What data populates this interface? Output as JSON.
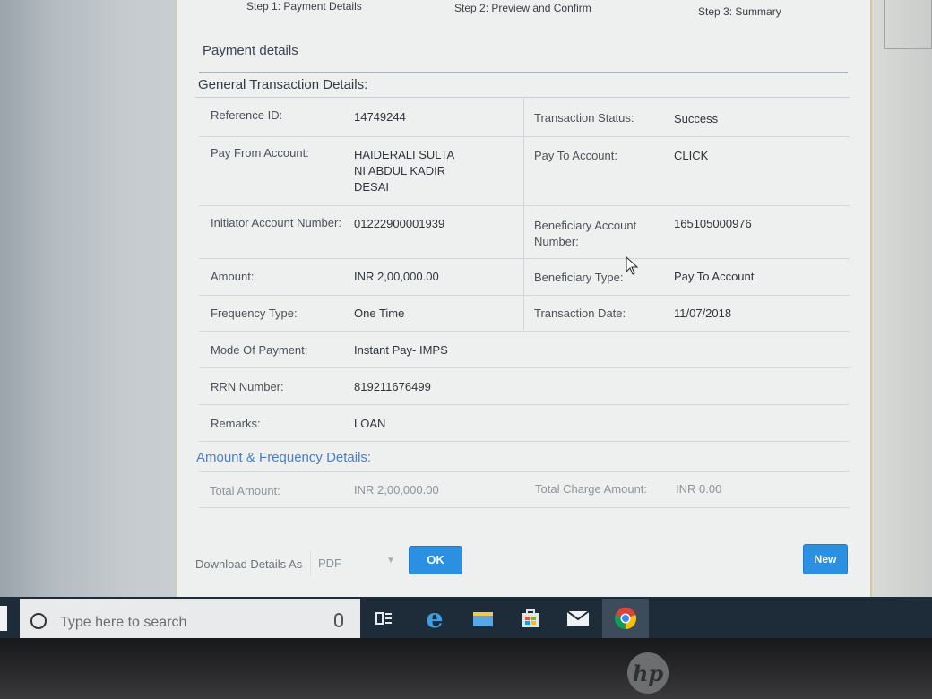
{
  "steps": [
    "Step 1: Payment Details",
    "Step 2: Preview and Confirm",
    "Step 3: Summary"
  ],
  "page_title": "Payment details",
  "general_section": {
    "heading": "General Transaction Details:",
    "rows": [
      {
        "label": "Reference ID:",
        "value": "14749244",
        "label2": "Transaction Status:",
        "value2": "Success"
      },
      {
        "label": "Pay From Account:",
        "value_lines": [
          "HAIDERALI SULTA",
          "NI ABDUL KADIR",
          "DESAI"
        ],
        "label2": "Pay To Account:",
        "value2": "CLICK"
      },
      {
        "label": "Initiator Account Number:",
        "value": "01222900001939",
        "label2_lines": [
          "Beneficiary Account",
          "Number:"
        ],
        "value2": "165105000976"
      },
      {
        "label": "Amount:",
        "value": "INR 2,00,000.00",
        "label2": "Beneficiary Type:",
        "value2": "Pay To Account"
      },
      {
        "label": "Frequency Type:",
        "value": "One Time",
        "label2": "Transaction Date:",
        "value2": "11/07/2018"
      },
      {
        "label": "Mode Of Payment:",
        "value": "Instant Pay- IMPS"
      },
      {
        "label": "RRN Number:",
        "value": "819211676499"
      },
      {
        "label": "Remarks:",
        "value": "LOAN"
      }
    ]
  },
  "amount_section": {
    "heading": "Amount & Frequency Details:",
    "total_amount_label": "Total Amount:",
    "total_amount_value": "INR 2,00,000.00",
    "total_charge_label": "Total Charge Amount:",
    "total_charge_value": "INR 0.00"
  },
  "footer": {
    "download_label": "Download Details As",
    "format_selected": "PDF",
    "ok_button": "OK",
    "new_button": "New"
  },
  "taskbar": {
    "search_placeholder": "Type here to search",
    "icons": [
      "task-view-icon",
      "edge-icon",
      "file-explorer-icon",
      "store-icon",
      "mail-icon",
      "chrome-icon"
    ]
  },
  "bezel": {
    "logo_text": "hp"
  },
  "colors": {
    "accent": "#2b8fe2",
    "section_blue": "#4d7cc7"
  }
}
